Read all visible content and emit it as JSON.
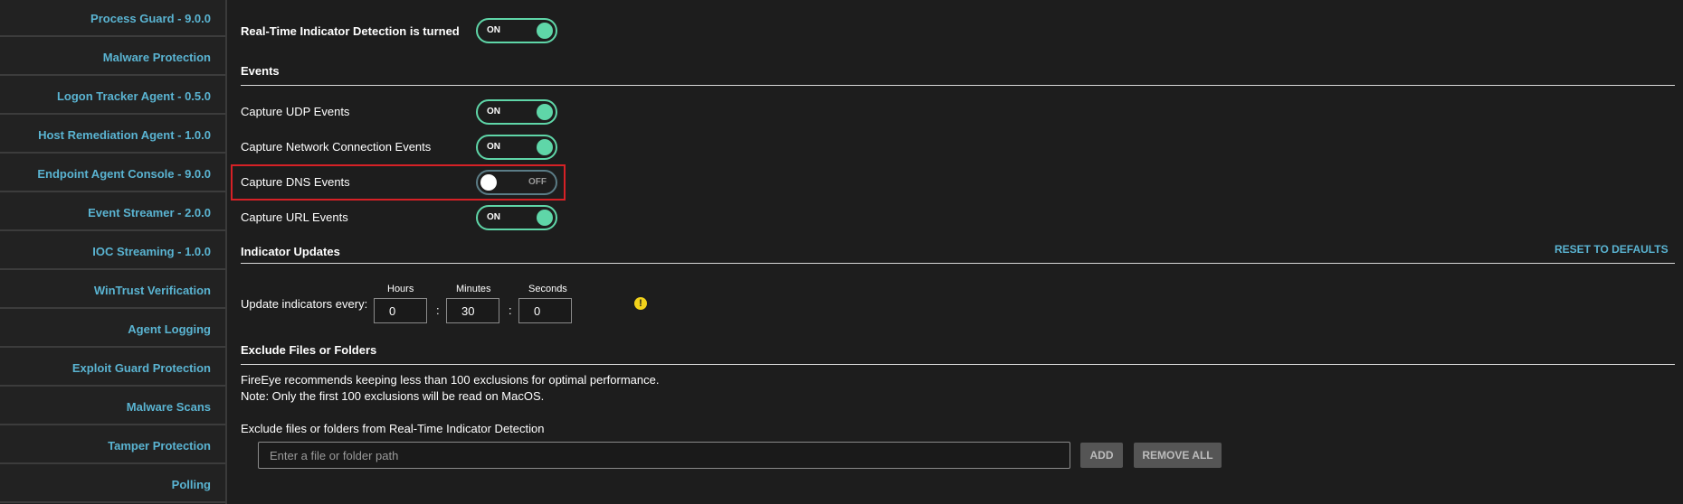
{
  "sidebar": {
    "items": [
      {
        "label": "Process Guard - 9.0.0"
      },
      {
        "label": "Malware Protection"
      },
      {
        "label": "Logon Tracker Agent - 0.5.0"
      },
      {
        "label": "Host Remediation Agent - 1.0.0"
      },
      {
        "label": "Endpoint Agent Console - 9.0.0"
      },
      {
        "label": "Event Streamer - 2.0.0"
      },
      {
        "label": "IOC Streaming - 1.0.0"
      },
      {
        "label": "WinTrust Verification"
      },
      {
        "label": "Agent Logging"
      },
      {
        "label": "Exploit Guard Protection"
      },
      {
        "label": "Malware Scans"
      },
      {
        "label": "Tamper Protection"
      },
      {
        "label": "Polling"
      }
    ]
  },
  "realtime": {
    "label": "Real-Time Indicator Detection is turned",
    "toggle": "ON"
  },
  "events": {
    "heading": "Events",
    "items": [
      {
        "label": "Capture UDP Events",
        "toggle": "ON"
      },
      {
        "label": "Capture Network Connection Events",
        "toggle": "ON"
      },
      {
        "label": "Capture DNS Events",
        "toggle": "OFF"
      },
      {
        "label": "Capture URL Events",
        "toggle": "ON"
      }
    ]
  },
  "indicator_updates": {
    "heading": "Indicator Updates",
    "reset_label": "RESET TO DEFAULTS",
    "update_label": "Update indicators every:",
    "hours_label": "Hours",
    "minutes_label": "Minutes",
    "seconds_label": "Seconds",
    "hours": "0",
    "minutes": "30",
    "seconds": "0",
    "separator": ":",
    "warning_glyph": "!"
  },
  "exclude": {
    "heading": "Exclude Files or Folders",
    "note1": "FireEye recommends keeping less than 100 exclusions for optimal performance.",
    "note2": "Note: Only the first 100 exclusions will be read on MacOS.",
    "field_label": "Exclude files or folders from Real-Time Indicator Detection",
    "placeholder": "Enter a file or folder path",
    "add_label": "ADD",
    "remove_all_label": "REMOVE ALL"
  },
  "colors": {
    "accent": "#5ab4d2",
    "toggle_on": "#5fd6a8",
    "highlight": "#d62126",
    "warning": "#f2d21b"
  }
}
